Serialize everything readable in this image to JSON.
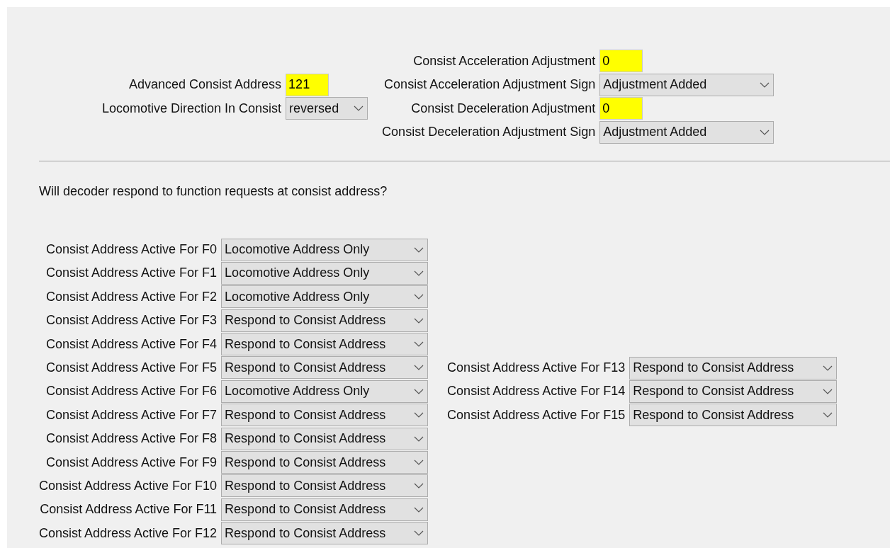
{
  "consist": {
    "left": [
      {
        "kind": "text",
        "label": "Advanced Consist Address",
        "value": "121"
      },
      {
        "kind": "select",
        "label": "Locomotive Direction In Consist",
        "value": "reversed"
      }
    ],
    "right": [
      {
        "kind": "text",
        "label": "Consist Acceleration Adjustment",
        "value": "0"
      },
      {
        "kind": "select",
        "label": "Consist Acceleration Adjustment Sign",
        "value": "Adjustment Added"
      },
      {
        "kind": "text",
        "label": "Consist Deceleration Adjustment",
        "value": "0"
      },
      {
        "kind": "select",
        "label": "Consist Deceleration Adjustment Sign",
        "value": "Adjustment Added"
      }
    ]
  },
  "question": "Will decoder respond to function requests at consist address?",
  "functions": {
    "left": [
      {
        "label": "Consist Address Active For F0",
        "value": "Locomotive Address Only"
      },
      {
        "label": "Consist Address Active For F1",
        "value": "Locomotive Address Only"
      },
      {
        "label": "Consist Address Active For F2",
        "value": "Locomotive Address Only"
      },
      {
        "label": "Consist Address Active For F3",
        "value": "Respond to Consist Address"
      },
      {
        "label": "Consist Address Active For F4",
        "value": "Respond to Consist Address"
      },
      {
        "label": "Consist Address Active For F5",
        "value": "Respond to Consist Address"
      },
      {
        "label": "Consist Address Active For F6",
        "value": "Locomotive Address Only"
      },
      {
        "label": "Consist Address Active For F7",
        "value": "Respond to Consist Address"
      },
      {
        "label": "Consist Address Active For F8",
        "value": "Respond to Consist Address"
      },
      {
        "label": "Consist Address Active For F9",
        "value": "Respond to Consist Address"
      },
      {
        "label": "Consist Address Active For F10",
        "value": "Respond to Consist Address"
      },
      {
        "label": "Consist Address Active For F11",
        "value": "Respond to Consist Address"
      },
      {
        "label": "Consist Address Active For F12",
        "value": "Respond to Consist Address"
      }
    ],
    "right": [
      {
        "label": "Consist Address Active For F13",
        "value": "Respond to Consist Address"
      },
      {
        "label": "Consist Address Active For F14",
        "value": "Respond to Consist Address"
      },
      {
        "label": "Consist Address Active For F15",
        "value": "Respond to Consist Address"
      }
    ]
  }
}
